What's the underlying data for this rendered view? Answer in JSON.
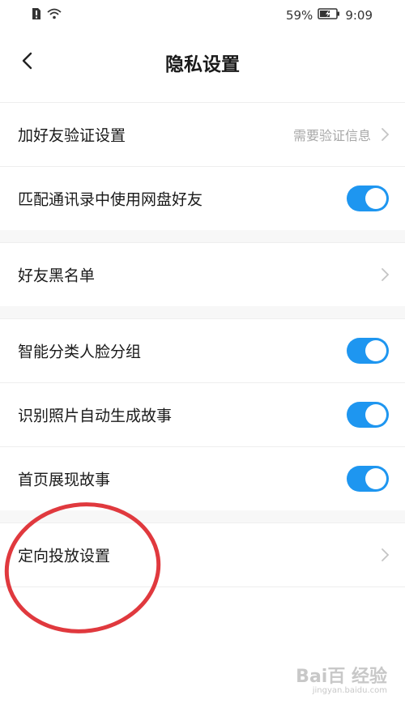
{
  "status_bar": {
    "battery_percent": "59%",
    "time": "9:09"
  },
  "header": {
    "title": "隐私设置"
  },
  "settings": [
    {
      "label": "加好友验证设置",
      "value": "需要验证信息",
      "type": "link"
    },
    {
      "label": "匹配通讯录中使用网盘好友",
      "type": "toggle",
      "on": true
    },
    {
      "label": "好友黑名单",
      "type": "link"
    },
    {
      "label": "智能分类人脸分组",
      "type": "toggle",
      "on": true
    },
    {
      "label": "识别照片自动生成故事",
      "type": "toggle",
      "on": true
    },
    {
      "label": "首页展现故事",
      "type": "toggle",
      "on": true
    },
    {
      "label": "定向投放设置",
      "type": "link"
    }
  ],
  "colors": {
    "toggle_on": "#1e96f0",
    "annotation": "#e0393e"
  },
  "watermark": {
    "brand": "Bai百 经验",
    "url": "jingyan.baidu.com"
  }
}
